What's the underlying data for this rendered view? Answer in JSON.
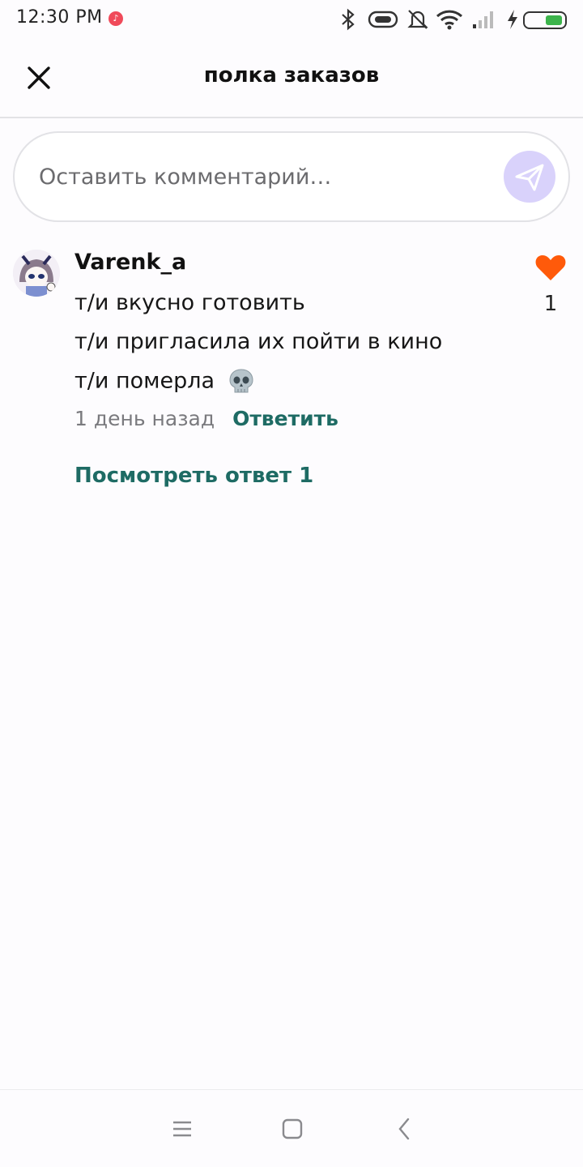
{
  "status_bar": {
    "time": "12:30 PM",
    "icons": [
      "music-icon",
      "bluetooth-icon",
      "vibrate-icon",
      "mute-bell-icon",
      "wifi-icon",
      "signal-icon",
      "charging-icon",
      "battery-icon"
    ],
    "battery_color": "#3cb44b"
  },
  "header": {
    "title": "полка заказов",
    "close_icon": "close-icon"
  },
  "composer": {
    "placeholder": "Оставить комментарий…",
    "send_icon": "send-icon",
    "send_bg": "#d9d2fb"
  },
  "comments": [
    {
      "author": "Varenk_a",
      "lines": [
        "т/и вкусно готовить",
        "т/и пригласила их пойти в кино",
        "т/и померла"
      ],
      "emoji": "skull-icon",
      "time_ago": "1 день назад",
      "reply_label": "Ответить",
      "likes": "1",
      "like_color": "#ff5a0a",
      "view_replies_label": "Посмотреть ответ 1"
    }
  ],
  "nav": {
    "buttons": [
      "menu-icon",
      "home-icon",
      "back-icon"
    ]
  },
  "accent": "#1e6b64"
}
